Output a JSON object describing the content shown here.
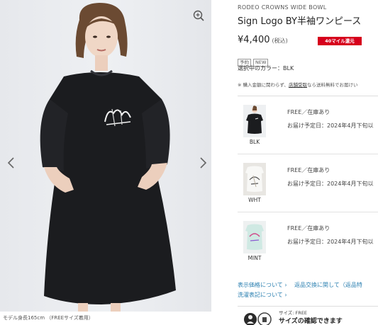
{
  "gallery": {
    "zoom_icon": "magnifier-plus-icon",
    "prev_icon": "chevron-left-icon",
    "next_icon": "chevron-right-icon",
    "caption": "モデル身長165cm （FREEサイズ着用）",
    "print_text": "RodeoC"
  },
  "product": {
    "brand": "RODEO CROWNS WIDE BOWL",
    "title": "Sign Logo BY半袖ワンピース",
    "price": "¥4,400",
    "tax": "(税込)",
    "mile_badge": "40マイル還元",
    "tags": [
      "予約",
      "NEW"
    ],
    "selected_color": "選択中のカラー：BLK",
    "note_prefix": "※ 購入金額に関わらず、",
    "note_link": "店舗受取",
    "note_suffix": "なら送料無料でお届けい"
  },
  "skus": [
    {
      "color": "BLK",
      "stock": "FREE／在庫あり",
      "delivery": "お届け予定日：2024年4月下旬以"
    },
    {
      "color": "WHT",
      "stock": "FREE／在庫あり",
      "delivery": "お届け予定日：2024年4月下旬以"
    },
    {
      "color": "MINT",
      "stock": "FREE／在庫あり",
      "delivery": "お届け予定日：2024年4月下旬以"
    }
  ],
  "links": {
    "display_price": "表示価格について",
    "returns": "返品交換に関して（返品特",
    "laundry": "洗濯表記について",
    "arrow": "›"
  },
  "size_box": {
    "size_label": "サイズ: FREE",
    "truncated_text": "サイズの確認できます"
  },
  "colors": {
    "accent_red": "#d6001c",
    "link_blue": "#2a7fb0",
    "dress_black": "#1b1c1f"
  }
}
